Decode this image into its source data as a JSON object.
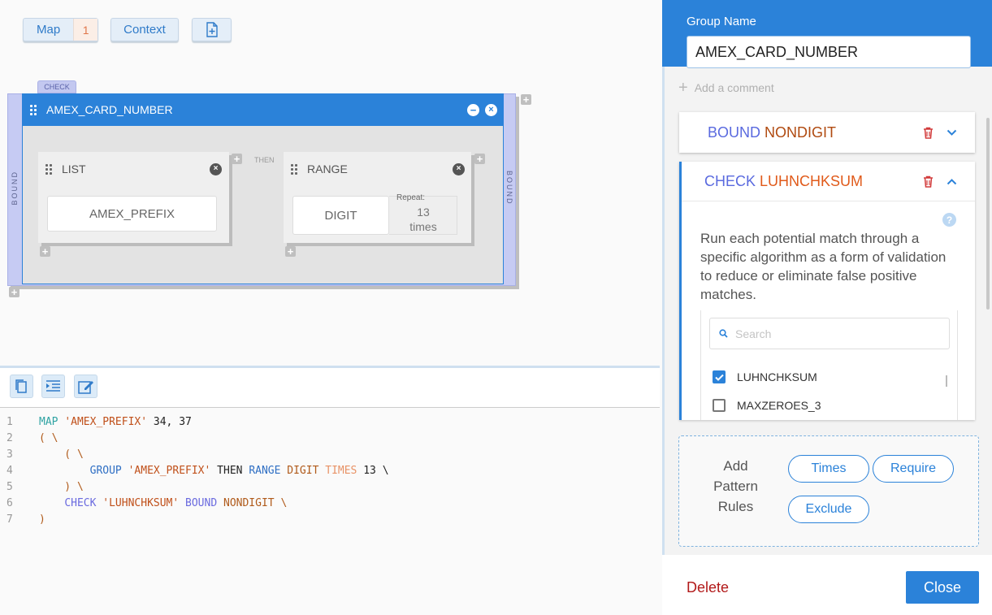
{
  "toolbar": {
    "map_label": "Map",
    "map_count": "1",
    "context_label": "Context"
  },
  "diagram": {
    "check_tag": "CHECK",
    "bound_left": "BOUND",
    "bound_right": "BOUND",
    "group_title": "AMEX_CARD_NUMBER",
    "then_label": "THEN",
    "list_card": {
      "title": "LIST",
      "item": "AMEX_PREFIX"
    },
    "range_card": {
      "title": "RANGE",
      "item": "DIGIT",
      "repeat_label": "Repeat:",
      "repeat_value": "13",
      "repeat_unit": "times"
    }
  },
  "code": {
    "line_numbers": [
      "1",
      "2",
      "3",
      "4",
      "5",
      "6",
      "7"
    ],
    "l1": {
      "a": "MAP",
      "b": "'AMEX_PREFIX'",
      "c": "34, 37"
    },
    "l2": "( \\",
    "l3": "    ( \\",
    "l4": {
      "a": "GROUP",
      "b": "'AMEX_PREFIX'",
      "c": "THEN",
      "d": "RANGE",
      "e": "DIGIT",
      "f": "TIMES",
      "g": "13 \\"
    },
    "l5": "    ) \\",
    "l6": {
      "a": "CHECK",
      "b": "'LUHNCHKSUM'",
      "c": "BOUND",
      "d": "NONDIGIT \\"
    },
    "l7": ")"
  },
  "panel": {
    "group_name_label": "Group Name",
    "group_name_value": "AMEX_CARD_NUMBER",
    "add_comment": "Add a comment",
    "rule1": {
      "kw": "BOUND",
      "val": "NONDIGIT"
    },
    "rule2": {
      "kw": "CHECK",
      "val": "LUHNCHKSUM",
      "description": "Run each potential match through a specific algorithm as a form of validation to reduce or eliminate false positive matches.",
      "search_placeholder": "Search",
      "options": [
        {
          "label": "LUHNCHKSUM",
          "checked": true
        },
        {
          "label": "MAXZEROES_3",
          "checked": false
        }
      ]
    },
    "add_rules": {
      "label": "Add Pattern Rules",
      "times": "Times",
      "require": "Require",
      "exclude": "Exclude"
    },
    "delete_label": "Delete",
    "close_label": "Close"
  },
  "colors": {
    "accent": "#2b82d9",
    "keyword_blue": "#5a6adf",
    "value_brown": "#b04a10",
    "danger": "#b21a1a"
  }
}
